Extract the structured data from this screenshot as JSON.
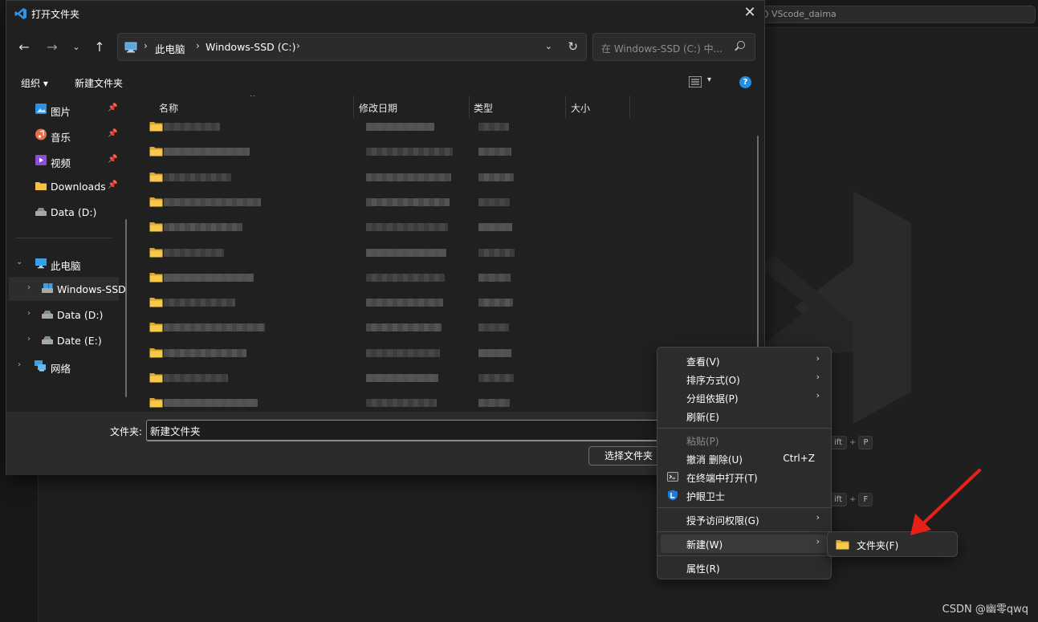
{
  "vscode": {
    "search_text": "VScode_daima",
    "shortcut_1": [
      "ift",
      "+",
      "P"
    ],
    "shortcut_2": [
      "ift",
      "+",
      "F"
    ]
  },
  "dialog": {
    "title": "打开文件夹",
    "close_glyph": "✕",
    "address": {
      "crumbs": [
        "此电脑",
        "Windows-SSD (C:)"
      ],
      "separator": "›"
    },
    "search_placeholder": "在 Windows-SSD (C:) 中...",
    "commands": {
      "organize": "组织 ▾",
      "new_folder": "新建文件夹"
    },
    "help_glyph": "?",
    "sidebar": {
      "quick_access": [
        {
          "label": "图片",
          "icon": "pictures-icon",
          "pinned": true
        },
        {
          "label": "音乐",
          "icon": "music-icon",
          "pinned": true
        },
        {
          "label": "视频",
          "icon": "videos-icon",
          "pinned": true
        },
        {
          "label": "Downloads",
          "icon": "downloads-folder-icon",
          "pinned": true
        },
        {
          "label": "Data (D:)",
          "icon": "drive-icon",
          "pinned": false
        }
      ],
      "tree": [
        {
          "label": "此电脑",
          "expanded": true
        },
        {
          "label": "Windows-SSD (C:)",
          "selected": true
        },
        {
          "label": "Data (D:)"
        },
        {
          "label": "Date (E:)"
        },
        {
          "label": "网络"
        }
      ]
    },
    "columns": [
      "名称",
      "修改日期",
      "类型",
      "大小"
    ],
    "folder_row_count": 12,
    "file_name_label": "文件夹:",
    "file_name_value": "新建文件夹",
    "select_button": "选择文件夹"
  },
  "context_menu": {
    "items": [
      {
        "label": "查看(V)",
        "submenu": true
      },
      {
        "label": "排序方式(O)",
        "submenu": true
      },
      {
        "label": "分组依据(P)",
        "submenu": true
      },
      {
        "label": "刷新(E)"
      },
      {
        "label": "粘贴(P)",
        "disabled": true
      },
      {
        "label": "撤消 删除(U)",
        "shortcut": "Ctrl+Z"
      },
      {
        "label": "在终端中打开(T)",
        "icon": "terminal-icon"
      },
      {
        "label": "护眼卫士",
        "icon": "shield-icon"
      },
      {
        "label": "授予访问权限(G)",
        "submenu": true
      },
      {
        "label": "新建(W)",
        "submenu": true,
        "highlighted": true
      },
      {
        "label": "属性(R)"
      }
    ],
    "new_submenu": [
      {
        "label": "文件夹(F)",
        "icon": "folder-icon"
      }
    ]
  },
  "watermark": "CSDN @幽零qwq",
  "colors": {
    "accent": "#1f8fe8",
    "folder": "#f5c143",
    "arrow": "#e8201a",
    "background": "#1f1f1f"
  }
}
